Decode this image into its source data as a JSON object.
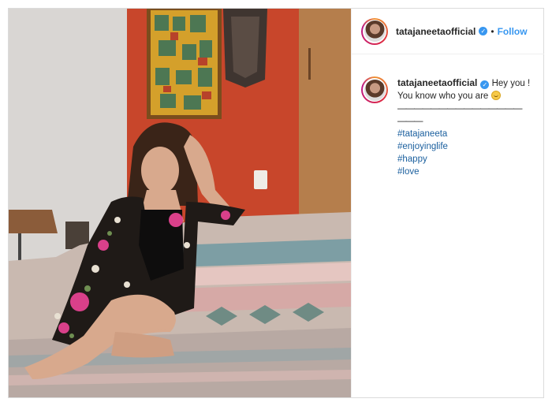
{
  "header": {
    "username": "tatajaneetaofficial",
    "verified_icon": "verified-badge-icon",
    "separator": "•",
    "follow_label": "Follow"
  },
  "caption": {
    "username": "tatajaneetaofficial",
    "text_line1": "Hey you !",
    "text_line2": "You know who you are",
    "emoji": "smiling-face-emoji",
    "divider": "———————————————",
    "divider2": "———",
    "hashtags": [
      "#tatajaneeta",
      "#enjoyinglife",
      "#happy",
      "#love"
    ]
  },
  "colors": {
    "link": "#3897f0",
    "hashtag": "#1a5f9e",
    "text": "#262626",
    "border": "#dbdbdb"
  }
}
